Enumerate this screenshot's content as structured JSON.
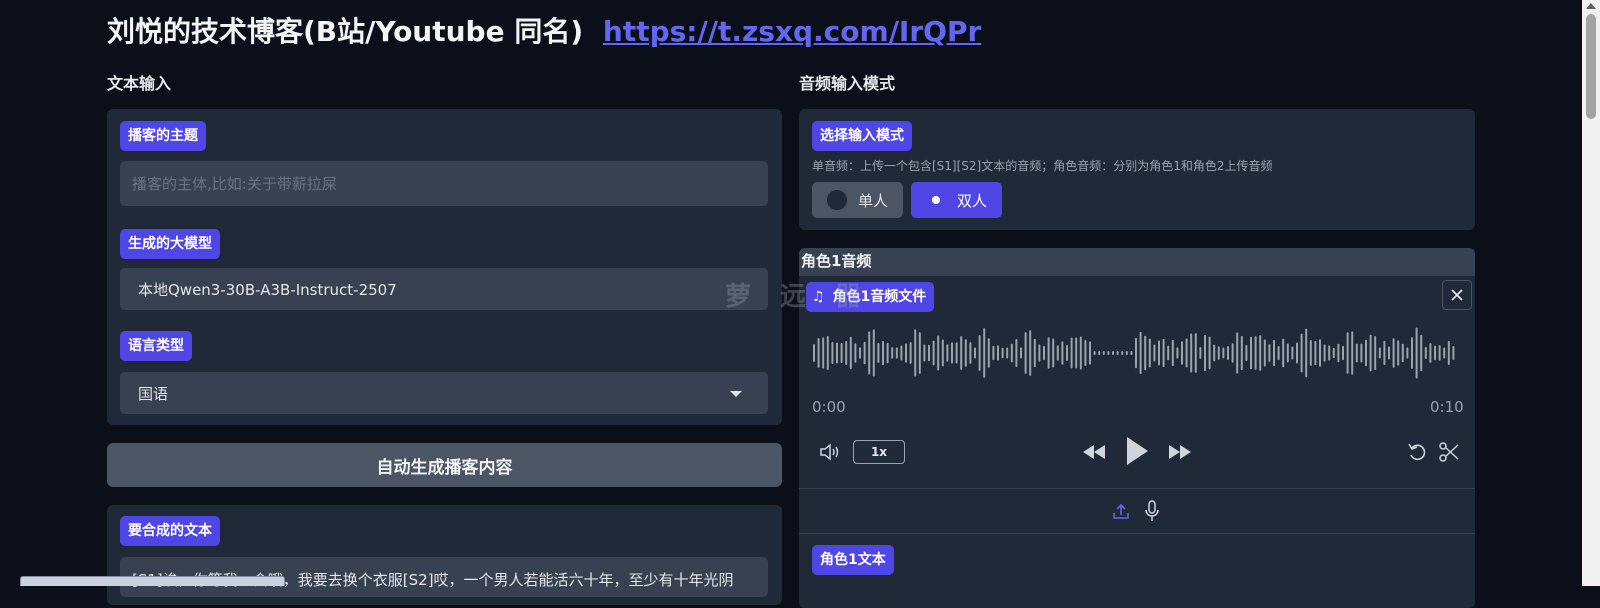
{
  "header": {
    "title": "刘悦的技术博客(B站/Youtube 同名)",
    "link_text": "https://t.zsxq.com/IrQPr"
  },
  "text_input": {
    "section_label": "文本输入",
    "topic": {
      "label": "播客的主题",
      "placeholder": "播客的主体,比如:关于带薪拉屎"
    },
    "model": {
      "label": "生成的大模型",
      "value": "本地Qwen3-30B-A3B-Instruct-2507"
    },
    "language": {
      "label": "语言类型",
      "value": "国语"
    },
    "generate_button": "自动生成播客内容",
    "synth_text": {
      "label": "要合成的文本",
      "value": "[S1]诶，你等我一会哦，我要去换个衣服[S2]哎，一个男人若能活六十年，至少有十年光阴"
    }
  },
  "audio_input": {
    "section_label": "音频输入模式",
    "mode": {
      "label": "选择输入模式",
      "hint": "单音频：上传一个包含[S1][S2]文本的音频；角色音频：分别为角色1和角色2上传音频",
      "options": [
        "单人",
        "双人"
      ],
      "selected": "双人"
    },
    "role1_audio": {
      "header": "角色1音频",
      "file_label": "角色1音频文件",
      "time_start": "0:00",
      "time_end": "0:10",
      "speed": "1x"
    },
    "role1_text": {
      "label": "角色1文本"
    }
  },
  "watermark": "萝 远 器",
  "icons": {
    "music": "music-note-icon",
    "close": "close-icon",
    "volume": "volume-icon",
    "rewind": "rewind-icon",
    "play": "play-icon",
    "forward": "fast-forward-icon",
    "undo": "undo-icon",
    "scissors": "scissors-icon",
    "upload": "upload-icon",
    "mic": "microphone-icon"
  },
  "colors": {
    "accent": "#4f46e5",
    "background": "#0b0f19",
    "panel": "#1f2937",
    "link": "#6366f1"
  }
}
